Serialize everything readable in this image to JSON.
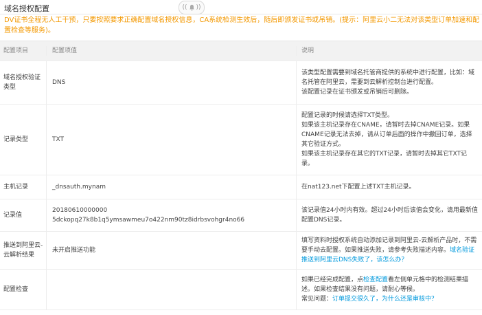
{
  "header": {
    "title": "域名授权配置"
  },
  "bell": {
    "left": "((",
    "right": "))"
  },
  "notice": "DV证书全程无人工干预，只要按照要求正确配置域名授权信息，CA系统检测生效后，随后即颁发证书或吊销。(提示：阿里云小二无法对该类型订单加速和配置检查等服务)。",
  "table": {
    "headers": [
      "配置项目",
      "配置项值",
      "说明"
    ],
    "rows": [
      {
        "name": "域名授权验证类型",
        "value": "DNS",
        "desc": [
          "该类型配置需要到域名托管商提供的系统中进行配置，比如：域名托管在阿里云，需要到云解析控制台进行配置。",
          "该配置记录在证书颁发或吊销后可删除。"
        ]
      },
      {
        "name": "记录类型",
        "value": "TXT",
        "desc": [
          "配置记录的时候请选择TXT类型。",
          "如果该主机记录存在CNAME，请暂时去掉CNAME记录。如果CNAME记录无法去掉，请从订单后面的操作中撤回订单，选择其它验证方式。",
          "如果该主机记录存在其它的TXT记录，请暂时去掉其它TXT记录。"
        ]
      },
      {
        "name": "主机记录",
        "value": "_dnsauth.mynam",
        "desc": [
          "在nat123.net下配置上述TXT主机记录。"
        ]
      },
      {
        "name": "记录值",
        "value": "20180610000000 5dckopq27k8b1q5ymsawmeu7o422nm90tz8idrbsvohgr4no66",
        "desc": [
          "该记录值24小时内有效。超过24小时后该值会变化，请用最新值配置DNS记录。"
        ]
      },
      {
        "name": "推送到阿里云-云解析结果",
        "value": "未开启推送功能",
        "desc_pre": "填写资料时授权系统自动添加记录到阿里云-云解析产品时，不需要手动去配置。如果推送失败，请参考失败描述内容。",
        "desc_link": "域名验证推送到阿里云DNS失败了，该怎么办？"
      },
      {
        "name": "配置检查",
        "value": "",
        "desc_a": "如果已经完成配置，点",
        "desc_a_link": "检查配置",
        "desc_a_post": "看左侧单元格中的检测结果描述。如果检查结果没有问题，请耐心等候。",
        "desc_b": "常见问题：",
        "desc_b_link": "订单提交很久了，为什么还是审核中？"
      }
    ]
  }
}
